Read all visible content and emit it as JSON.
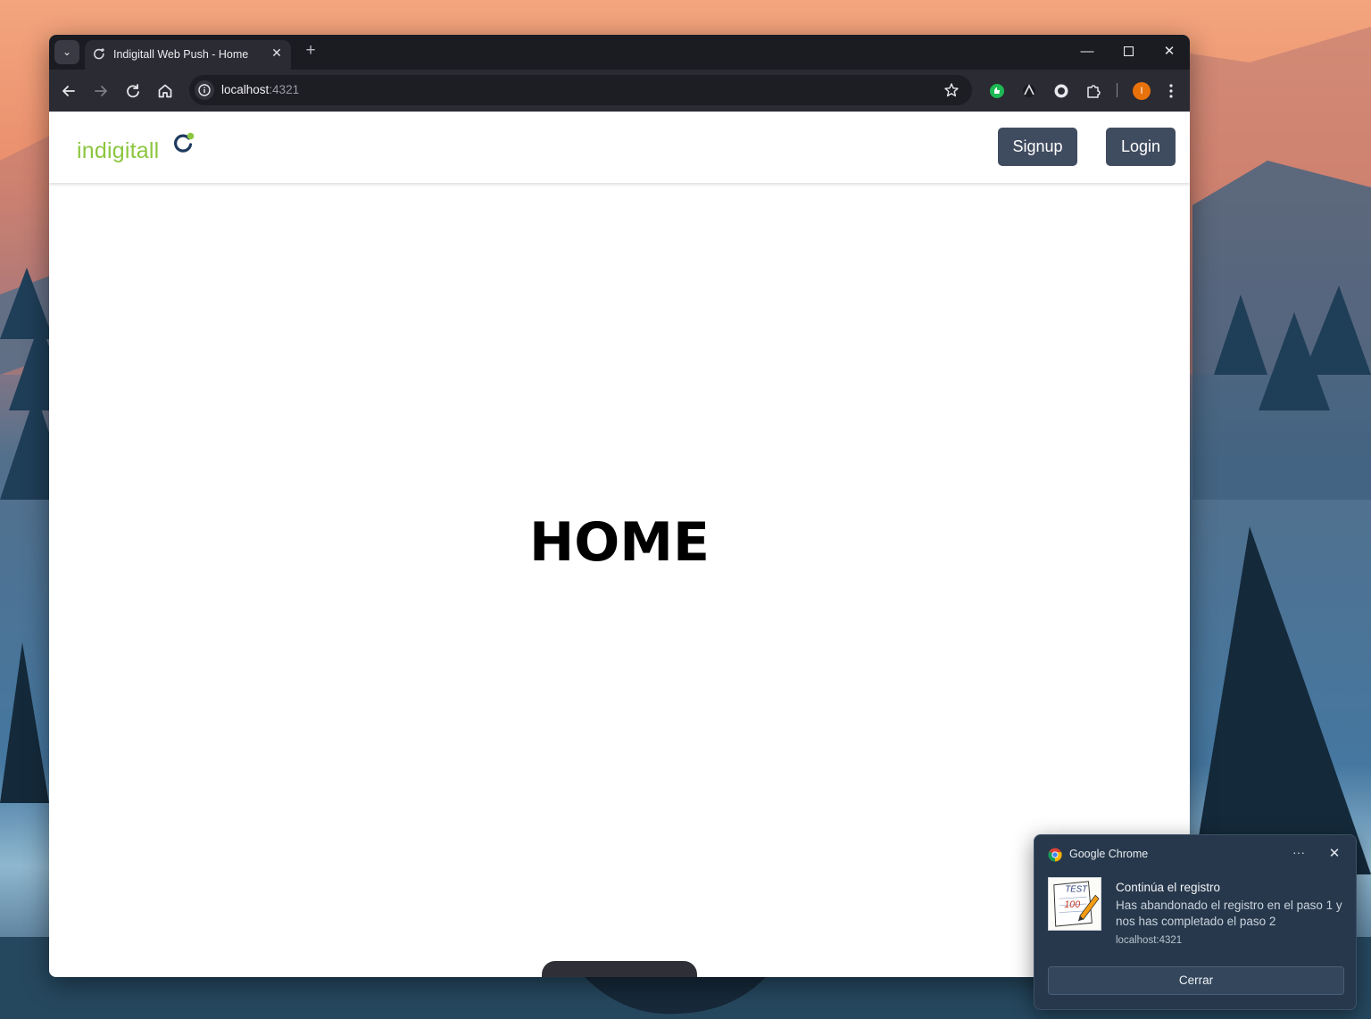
{
  "browser": {
    "tab_title": "Indigitall Web Push - Home",
    "new_tab_symbol": "+",
    "address": {
      "host": "localhost",
      "port": ":4321"
    },
    "profile_initial": "I"
  },
  "site": {
    "logo_text": "indigitall",
    "nav": {
      "signup_label": "Signup",
      "login_label": "Login"
    },
    "heading": "HOME"
  },
  "notification": {
    "app_name": "Google Chrome",
    "title": "Continúa el registro",
    "body": "Has abandonado el registro en el paso 1 y nos has completado el paso 2",
    "origin": "localhost:4321",
    "action_label": "Cerrar",
    "image_text": {
      "top": "TEST",
      "score": "100"
    }
  },
  "colors": {
    "logo_green": "#8cc63f",
    "logo_navy": "#1e3a5f",
    "button_bg": "#3f4b5f",
    "profile_orange": "#e8710a"
  },
  "icons": [
    "tab-search-icon",
    "favicon-icon",
    "close-icon",
    "back-icon",
    "forward-icon",
    "reload-icon",
    "home-icon",
    "site-info-icon",
    "bookmark-star-icon",
    "extension-icon",
    "puzzle-icon",
    "kebab-menu-icon",
    "chrome-logo-icon"
  ]
}
